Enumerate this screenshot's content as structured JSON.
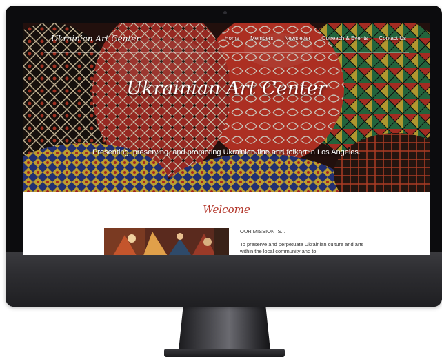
{
  "site": {
    "logo_text": "Ukrainian Art Center",
    "nav": [
      "Home",
      "Members",
      "Newsletter",
      "Outreach & Events",
      "Contact Us"
    ],
    "hero_title": "Ukrainian Art Center",
    "hero_subtitle": "Presenting, preserving, and promoting Ukrainian fine and folkart in Los Angeles.",
    "welcome_heading": "Welcome",
    "mission_heading": "OUR MISSION IS...",
    "mission_text": "To preserve and perpetuate Ukrainian culture and arts within the local community and to"
  },
  "colors": {
    "accent_red": "#b3362a",
    "bezel": "#0c0c0e"
  }
}
